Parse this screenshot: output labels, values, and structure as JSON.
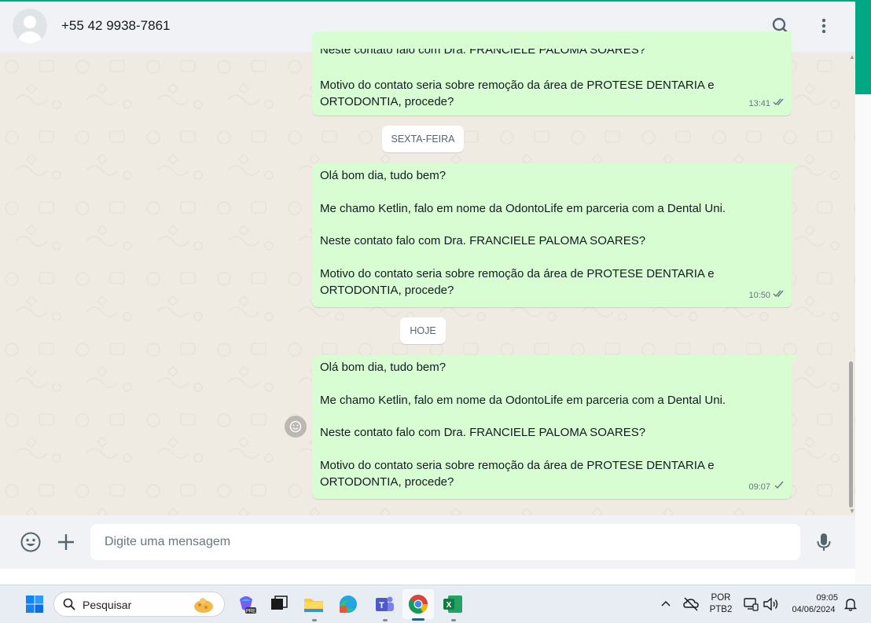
{
  "header": {
    "contact_name": "+55 42 9938-7861",
    "search_icon": "search-icon",
    "menu_icon": "kebab-menu-icon"
  },
  "messages": [
    {
      "line_partial": "Neste contato falo com Dra. FRANCIELE PALOMA SOARES?",
      "text": "Motivo do contato seria sobre remoção da área de PROTESE DENTARIA e ORTODONTIA, procede?",
      "time": "13:41",
      "status": "read"
    },
    {
      "date_chip": "SEXTA-FEIRA",
      "text": "Olá bom dia, tudo bem?\n\nMe chamo Ketlin, falo em nome da OdontoLife em parceria com a Dental Uni.\n\nNeste contato falo com Dra. FRANCIELE PALOMA SOARES?\n\nMotivo do contato seria sobre remoção da área de PROTESE DENTARIA e ORTODONTIA, procede?",
      "time": "10:50",
      "status": "read"
    },
    {
      "date_chip": "HOJE",
      "text": "Olá bom dia, tudo bem?\n\nMe chamo Ketlin, falo em nome da OdontoLife em parceria com a Dental Uni.\n\nNeste contato falo com Dra. FRANCIELE PALOMA SOARES?\n\nMotivo do contato seria sobre remoção da área de PROTESE DENTARIA e ORTODONTIA, procede?",
      "time": "09:07",
      "status": "sent"
    }
  ],
  "composer": {
    "placeholder": "Digite uma mensagem",
    "emoji_icon": "emoji-icon",
    "attach_icon": "plus-icon",
    "mic_icon": "microphone-icon"
  },
  "taskbar": {
    "search_label": "Pesquisar",
    "language_line1": "POR",
    "language_line2": "PTB2",
    "clock_time": "09:05",
    "clock_date": "04/06/2024",
    "apps": [
      "windows-start",
      "copilot",
      "task-view",
      "file-explorer",
      "microsoft-store",
      "teams",
      "chrome",
      "excel"
    ]
  },
  "colors": {
    "accent": "#00a884",
    "outgoing_bubble": "#d9fdd3",
    "chat_background": "#efeae2",
    "read_ticks": "#667781"
  }
}
